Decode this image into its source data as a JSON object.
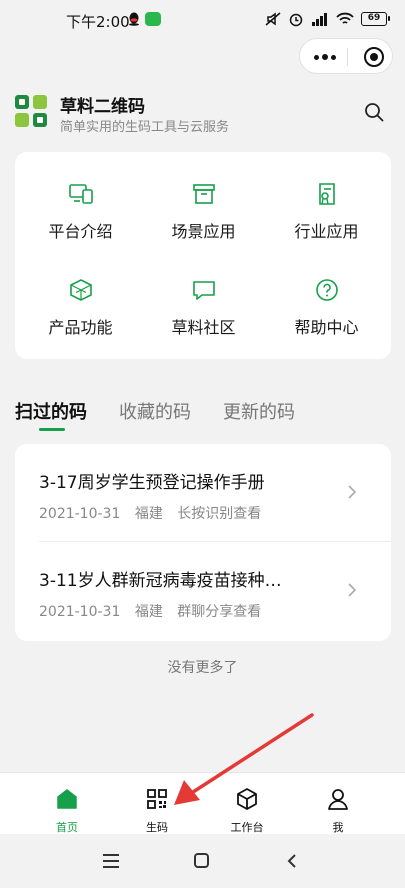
{
  "status_bar": {
    "time": "下午2:00",
    "battery": "69"
  },
  "header": {
    "title": "草料二维码",
    "subtitle": "简单实用的生码工具与云服务"
  },
  "grid": [
    {
      "label": "平台介绍",
      "icon": "devices-icon"
    },
    {
      "label": "场景应用",
      "icon": "archive-box-icon"
    },
    {
      "label": "行业应用",
      "icon": "certificate-icon"
    },
    {
      "label": "产品功能",
      "icon": "cube-icon"
    },
    {
      "label": "草料社区",
      "icon": "chat-bubble-icon"
    },
    {
      "label": "帮助中心",
      "icon": "help-circle-icon"
    }
  ],
  "tabs": [
    {
      "label": "扫过的码",
      "active": true
    },
    {
      "label": "收藏的码",
      "active": false
    },
    {
      "label": "更新的码",
      "active": false
    }
  ],
  "list": [
    {
      "title": "3-17周岁学生预登记操作手册",
      "date": "2021-10-31",
      "location": "福建",
      "action": "长按识别查看"
    },
    {
      "title": "3-11岁人群新冠病毒疫苗接种…",
      "date": "2021-10-31",
      "location": "福建",
      "action": "群聊分享查看"
    }
  ],
  "no_more": "没有更多了",
  "tab_bar": [
    {
      "label": "首页",
      "icon": "home-icon",
      "active": true
    },
    {
      "label": "生码",
      "icon": "qr-code-icon",
      "active": false
    },
    {
      "label": "工作台",
      "icon": "workbench-cube-icon",
      "active": false
    },
    {
      "label": "我",
      "icon": "user-icon",
      "active": false
    }
  ],
  "colors": {
    "accent": "#17a04a",
    "annotation_arrow": "#e53935"
  }
}
